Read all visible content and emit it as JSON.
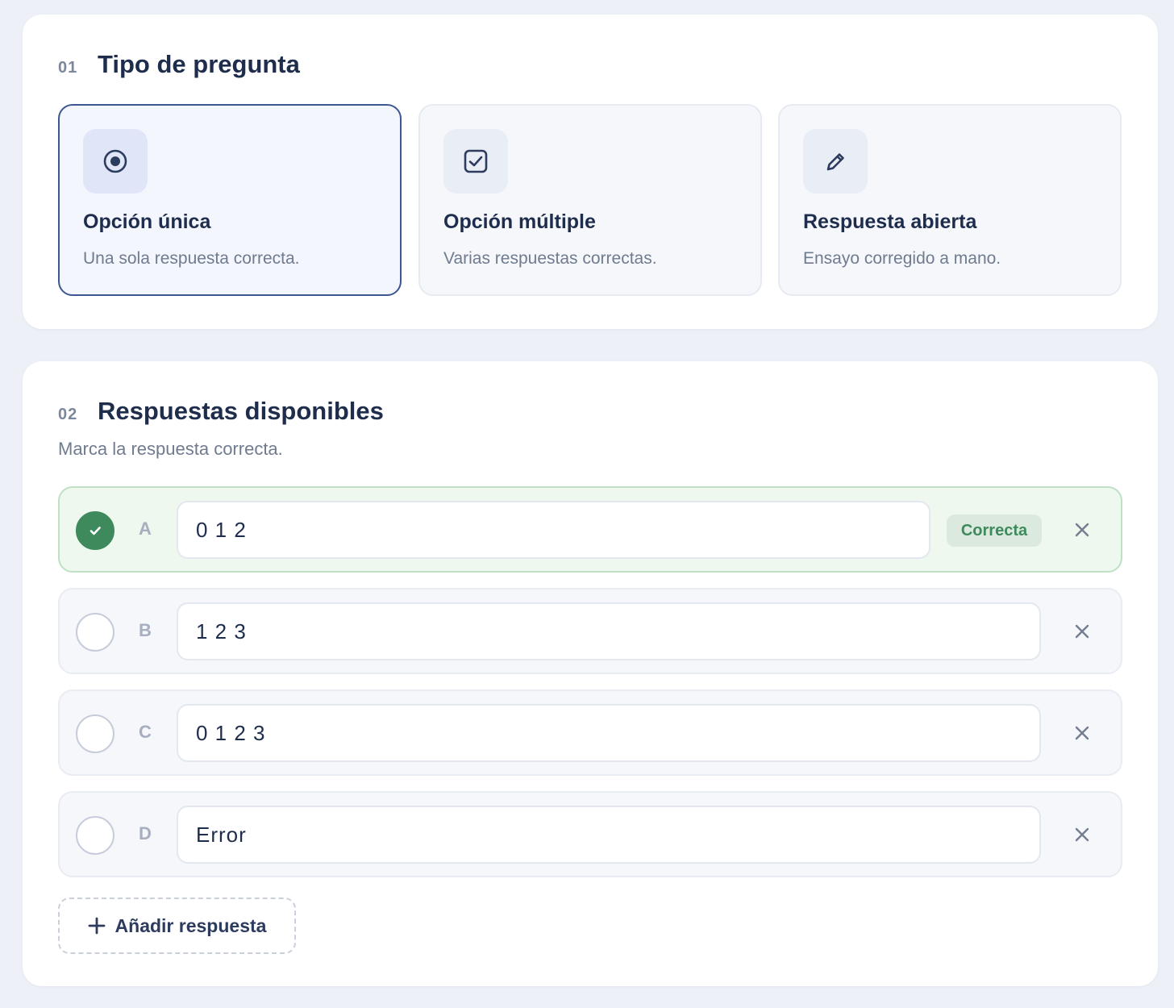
{
  "section1": {
    "number": "01",
    "title": "Tipo de pregunta",
    "options": [
      {
        "title": "Opción única",
        "description": "Una sola respuesta correcta.",
        "icon": "radio-button-icon",
        "selected": true
      },
      {
        "title": "Opción múltiple",
        "description": "Varias respuestas correctas.",
        "icon": "checkbox-icon",
        "selected": false
      },
      {
        "title": "Respuesta abierta",
        "description": "Ensayo corregido a mano.",
        "icon": "pencil-icon",
        "selected": false
      }
    ]
  },
  "section2": {
    "number": "02",
    "title": "Respuestas disponibles",
    "subtitle": "Marca la respuesta correcta.",
    "answers": [
      {
        "letter": "A",
        "value": "0 1 2",
        "correct": true
      },
      {
        "letter": "B",
        "value": "1 2 3",
        "correct": false
      },
      {
        "letter": "C",
        "value": "0 1 2 3",
        "correct": false
      },
      {
        "letter": "D",
        "value": "Error",
        "correct": false
      }
    ],
    "correct_badge": "Correcta",
    "add_label": "Añadir respuesta"
  },
  "colors": {
    "accent": "#3d5791",
    "correct": "#3f8a5c",
    "background": "#edf0f7"
  }
}
